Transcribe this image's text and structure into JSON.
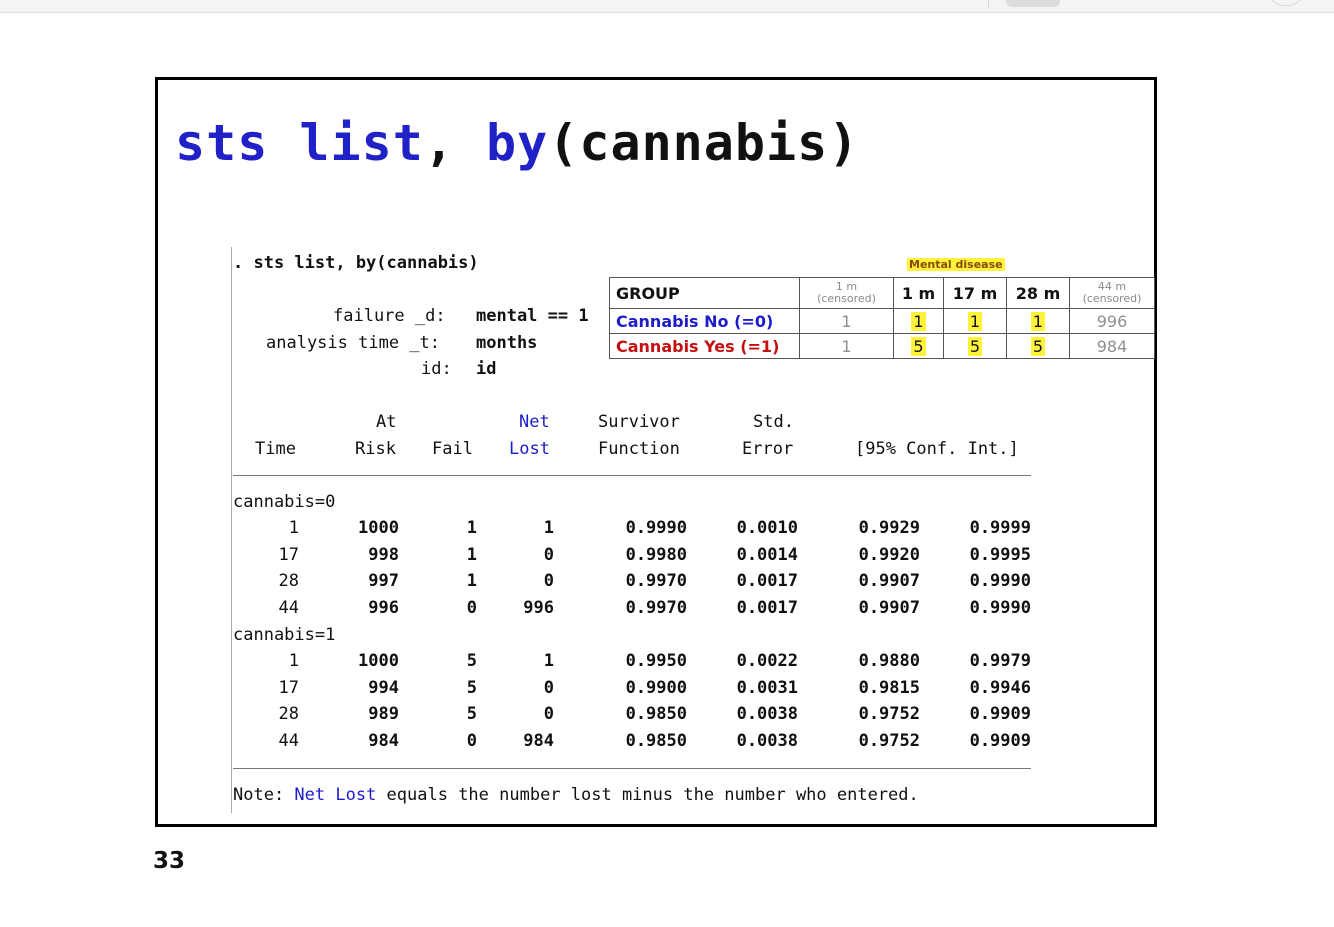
{
  "slide": {
    "title_kw1": "sts list",
    "title_comma": ", ",
    "title_kw2": "by",
    "title_rest": "(cannabis)",
    "page_number": "33"
  },
  "console": {
    "command": ". sts list, by(cannabis)",
    "failure_label": "failure _d:",
    "failure_value": "mental == 1",
    "analysis_label": "analysis time _t:",
    "analysis_value": "months",
    "id_label": "id:",
    "id_value": "id",
    "headers": {
      "at": "At",
      "net": "Net",
      "survivor": "Survivor",
      "std": "Std.",
      "time": "Time",
      "risk": "Risk",
      "fail": "Fail",
      "lost": "Lost",
      "function": "Function",
      "error": "Error",
      "ci": "[95% Conf. Int.]"
    },
    "groups": [
      {
        "label": "cannabis=0",
        "rows": [
          {
            "time": "1",
            "risk": "1000",
            "fail": "1",
            "lost": "1",
            "surv": "0.9990",
            "se": "0.0010",
            "lo": "0.9929",
            "hi": "0.9999"
          },
          {
            "time": "17",
            "risk": "998",
            "fail": "1",
            "lost": "0",
            "surv": "0.9980",
            "se": "0.0014",
            "lo": "0.9920",
            "hi": "0.9995"
          },
          {
            "time": "28",
            "risk": "997",
            "fail": "1",
            "lost": "0",
            "surv": "0.9970",
            "se": "0.0017",
            "lo": "0.9907",
            "hi": "0.9990"
          },
          {
            "time": "44",
            "risk": "996",
            "fail": "0",
            "lost": "996",
            "surv": "0.9970",
            "se": "0.0017",
            "lo": "0.9907",
            "hi": "0.9990"
          }
        ]
      },
      {
        "label": "cannabis=1",
        "rows": [
          {
            "time": "1",
            "risk": "1000",
            "fail": "5",
            "lost": "1",
            "surv": "0.9950",
            "se": "0.0022",
            "lo": "0.9880",
            "hi": "0.9979"
          },
          {
            "time": "17",
            "risk": "994",
            "fail": "5",
            "lost": "0",
            "surv": "0.9900",
            "se": "0.0031",
            "lo": "0.9815",
            "hi": "0.9946"
          },
          {
            "time": "28",
            "risk": "989",
            "fail": "5",
            "lost": "0",
            "surv": "0.9850",
            "se": "0.0038",
            "lo": "0.9752",
            "hi": "0.9909"
          },
          {
            "time": "44",
            "risk": "984",
            "fail": "0",
            "lost": "984",
            "surv": "0.9850",
            "se": "0.0038",
            "lo": "0.9752",
            "hi": "0.9909"
          }
        ]
      }
    ],
    "note_prefix": "Note: ",
    "note_highlight": "Net Lost",
    "note_suffix": " equals the number lost minus the number who entered."
  },
  "overlay": {
    "tag": "Mental disease",
    "group_header": "GROUP",
    "col1": "1 m",
    "col1_sub": "(censored)",
    "col2": "1 m",
    "col3": "17 m",
    "col4": "28 m",
    "col5": "44 m",
    "col5_sub": "(censored)",
    "row_no": {
      "label": "Cannabis No (=0)",
      "c1": "1",
      "c2": "1",
      "c3": "1",
      "c4": "1",
      "c5": "996"
    },
    "row_yes": {
      "label": "Cannabis Yes (=1)",
      "c1": "1",
      "c2": "5",
      "c3": "5",
      "c4": "5",
      "c5": "984"
    }
  },
  "colors": {
    "keyword": "#2121c8",
    "highlight": "#fff23a",
    "no_group": "#1d1dcc",
    "yes_group": "#c41010"
  }
}
